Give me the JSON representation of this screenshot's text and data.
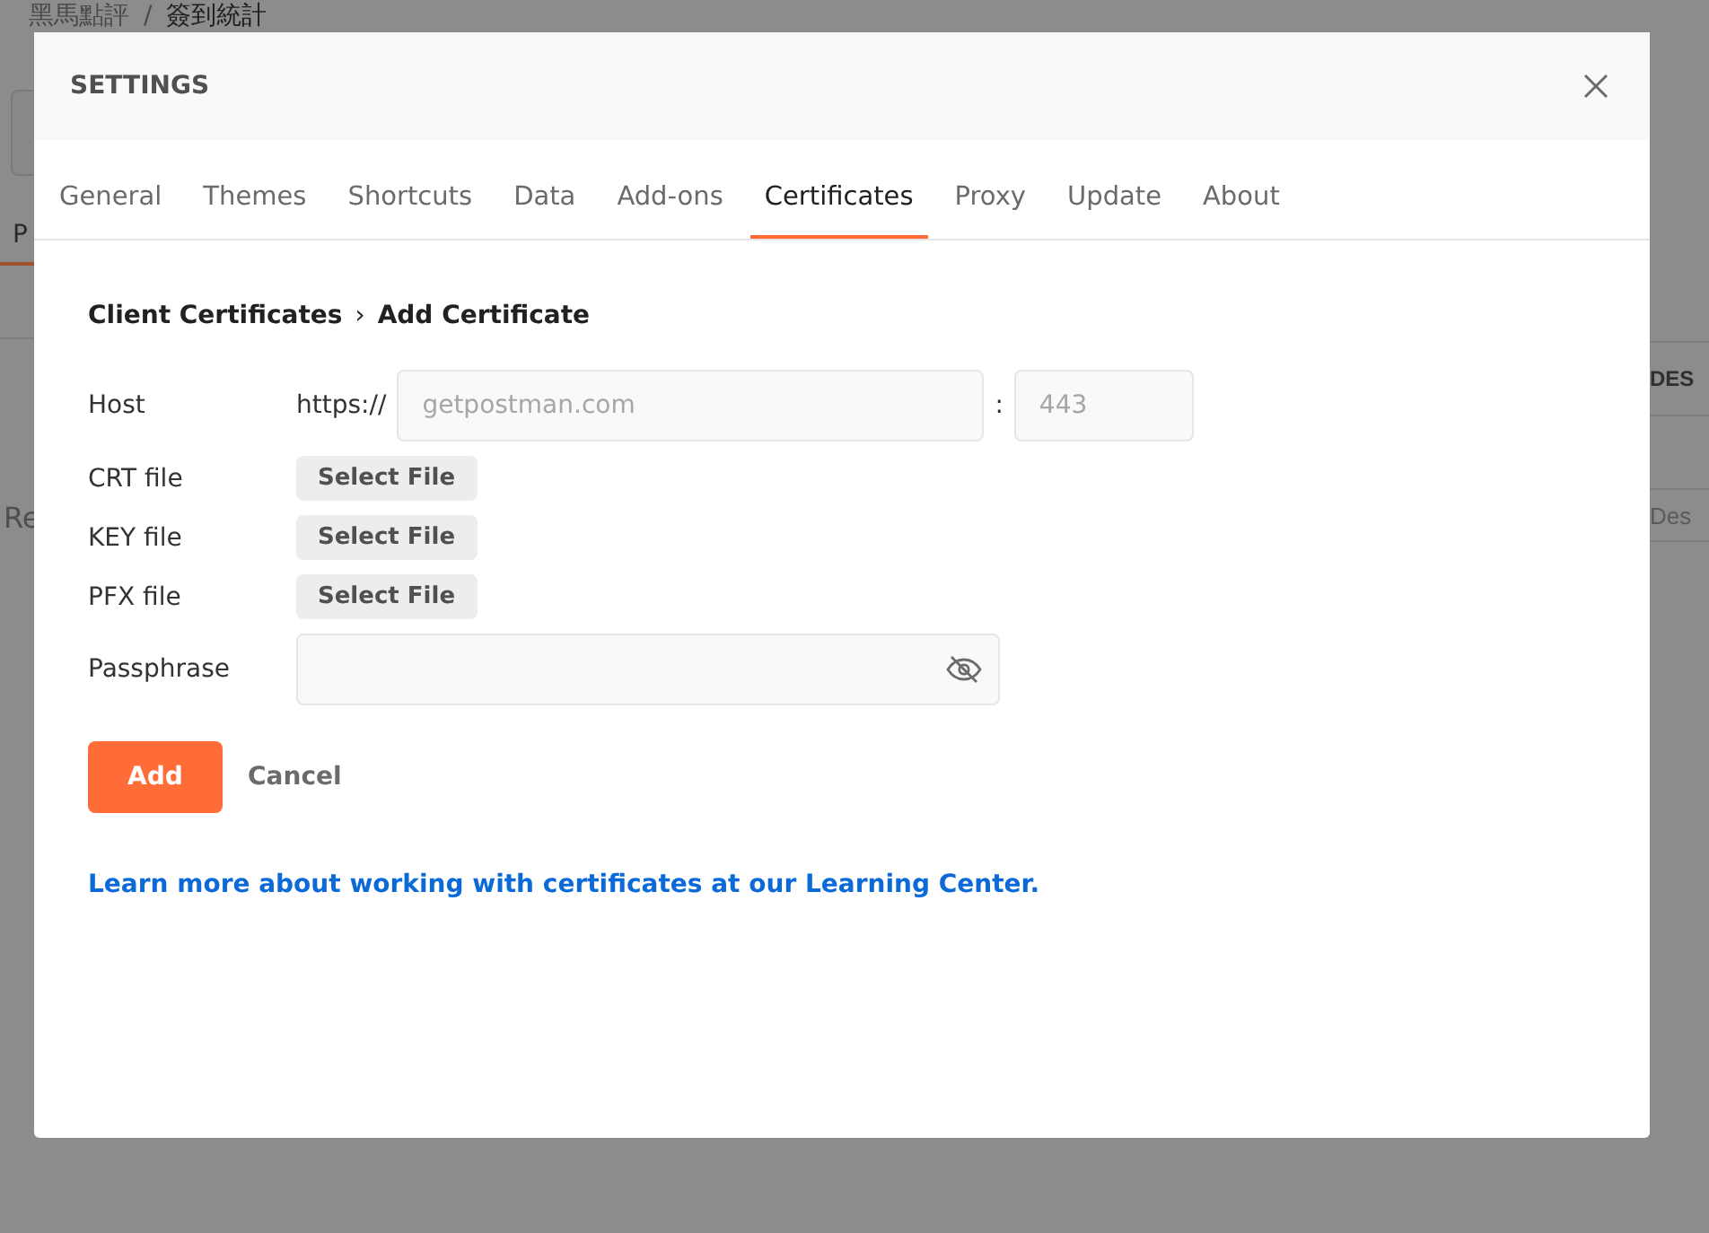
{
  "background": {
    "breadcrumb": [
      "黑馬點評",
      "簽到統計"
    ],
    "breadcrumb_separator": "/",
    "left_fragments": [
      {
        "text": "P",
        "kind": "tab"
      },
      {
        "text": "Re",
        "kind": "plain"
      }
    ],
    "right_fragments": [
      {
        "text": "DES",
        "kind": "header"
      },
      {
        "text": "Des",
        "kind": "cell"
      }
    ]
  },
  "dialog": {
    "title": "SETTINGS",
    "tabs": [
      {
        "label": "General",
        "selected": false
      },
      {
        "label": "Themes",
        "selected": false
      },
      {
        "label": "Shortcuts",
        "selected": false
      },
      {
        "label": "Data",
        "selected": false
      },
      {
        "label": "Add-ons",
        "selected": false
      },
      {
        "label": "Certificates",
        "selected": true
      },
      {
        "label": "Proxy",
        "selected": false
      },
      {
        "label": "Update",
        "selected": false
      },
      {
        "label": "About",
        "selected": false
      }
    ],
    "breadcrumb": [
      "Client Certificates",
      "Add Certificate"
    ],
    "breadcrumb_separator": "›",
    "form": {
      "host": {
        "label": "Host",
        "prefix": "https://",
        "placeholder": "getpostman.com",
        "separator": ":",
        "port_placeholder": "443"
      },
      "files": [
        {
          "label": "CRT file",
          "button": "Select File"
        },
        {
          "label": "KEY file",
          "button": "Select File"
        },
        {
          "label": "PFX file",
          "button": "Select File"
        }
      ],
      "passphrase": {
        "label": "Passphrase"
      }
    },
    "buttons": {
      "primary": "Add",
      "secondary": "Cancel"
    },
    "link": "Learn more about working with certificates at our Learning Center."
  }
}
